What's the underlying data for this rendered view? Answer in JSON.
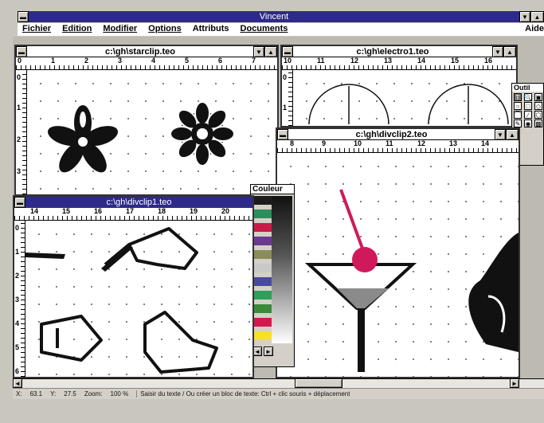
{
  "app": {
    "title": "Vincent"
  },
  "menu": {
    "items": [
      "Fichier",
      "Edition",
      "Modifier",
      "Options",
      "Attributs",
      "Documents"
    ],
    "help": "Aide"
  },
  "windows": {
    "starclip": {
      "title": "c:\\gh\\starclip.teo",
      "ruler": [
        "0",
        "1",
        "2",
        "3",
        "4",
        "5",
        "6",
        "7"
      ],
      "vruler": [
        "0",
        "1",
        "2",
        "3"
      ]
    },
    "electro": {
      "title": "c:\\gh\\electro1.teo",
      "ruler": [
        "10",
        "11",
        "12",
        "13",
        "14",
        "15",
        "16"
      ],
      "vruler": [
        "0",
        "1"
      ]
    },
    "divclip2": {
      "title": "c:\\gh\\divclip2.teo",
      "ruler": [
        "8",
        "9",
        "10",
        "11",
        "12",
        "13",
        "14"
      ]
    },
    "divclip1": {
      "title": "c:\\gh\\divclip1.teo",
      "ruler": [
        "14",
        "15",
        "16",
        "17",
        "18",
        "19",
        "20"
      ],
      "vruler": [
        "0",
        "1",
        "2",
        "3",
        "4",
        "5",
        "6"
      ]
    }
  },
  "palette": {
    "title": "Couleur",
    "colors": [
      "#1b1b1b",
      "#2b8f5b",
      "#c81b4a",
      "#6a3b8c",
      "#8c8c5a",
      "#c9c9c9",
      "#4a4a9c",
      "#2ba05a",
      "#3a8a3a",
      "#d1184f",
      "#f5e12a"
    ]
  },
  "tools": {
    "title": "Outil"
  },
  "status": {
    "x_label": "X:",
    "x_value": "63.1",
    "y_label": "Y:",
    "y_value": "27.5",
    "zoom_label": "Zoom:",
    "zoom_value": "100 %",
    "message": "Saisir du texte / Ou créer un bloc de texte: Ctrl + clic souris + déplacement"
  }
}
